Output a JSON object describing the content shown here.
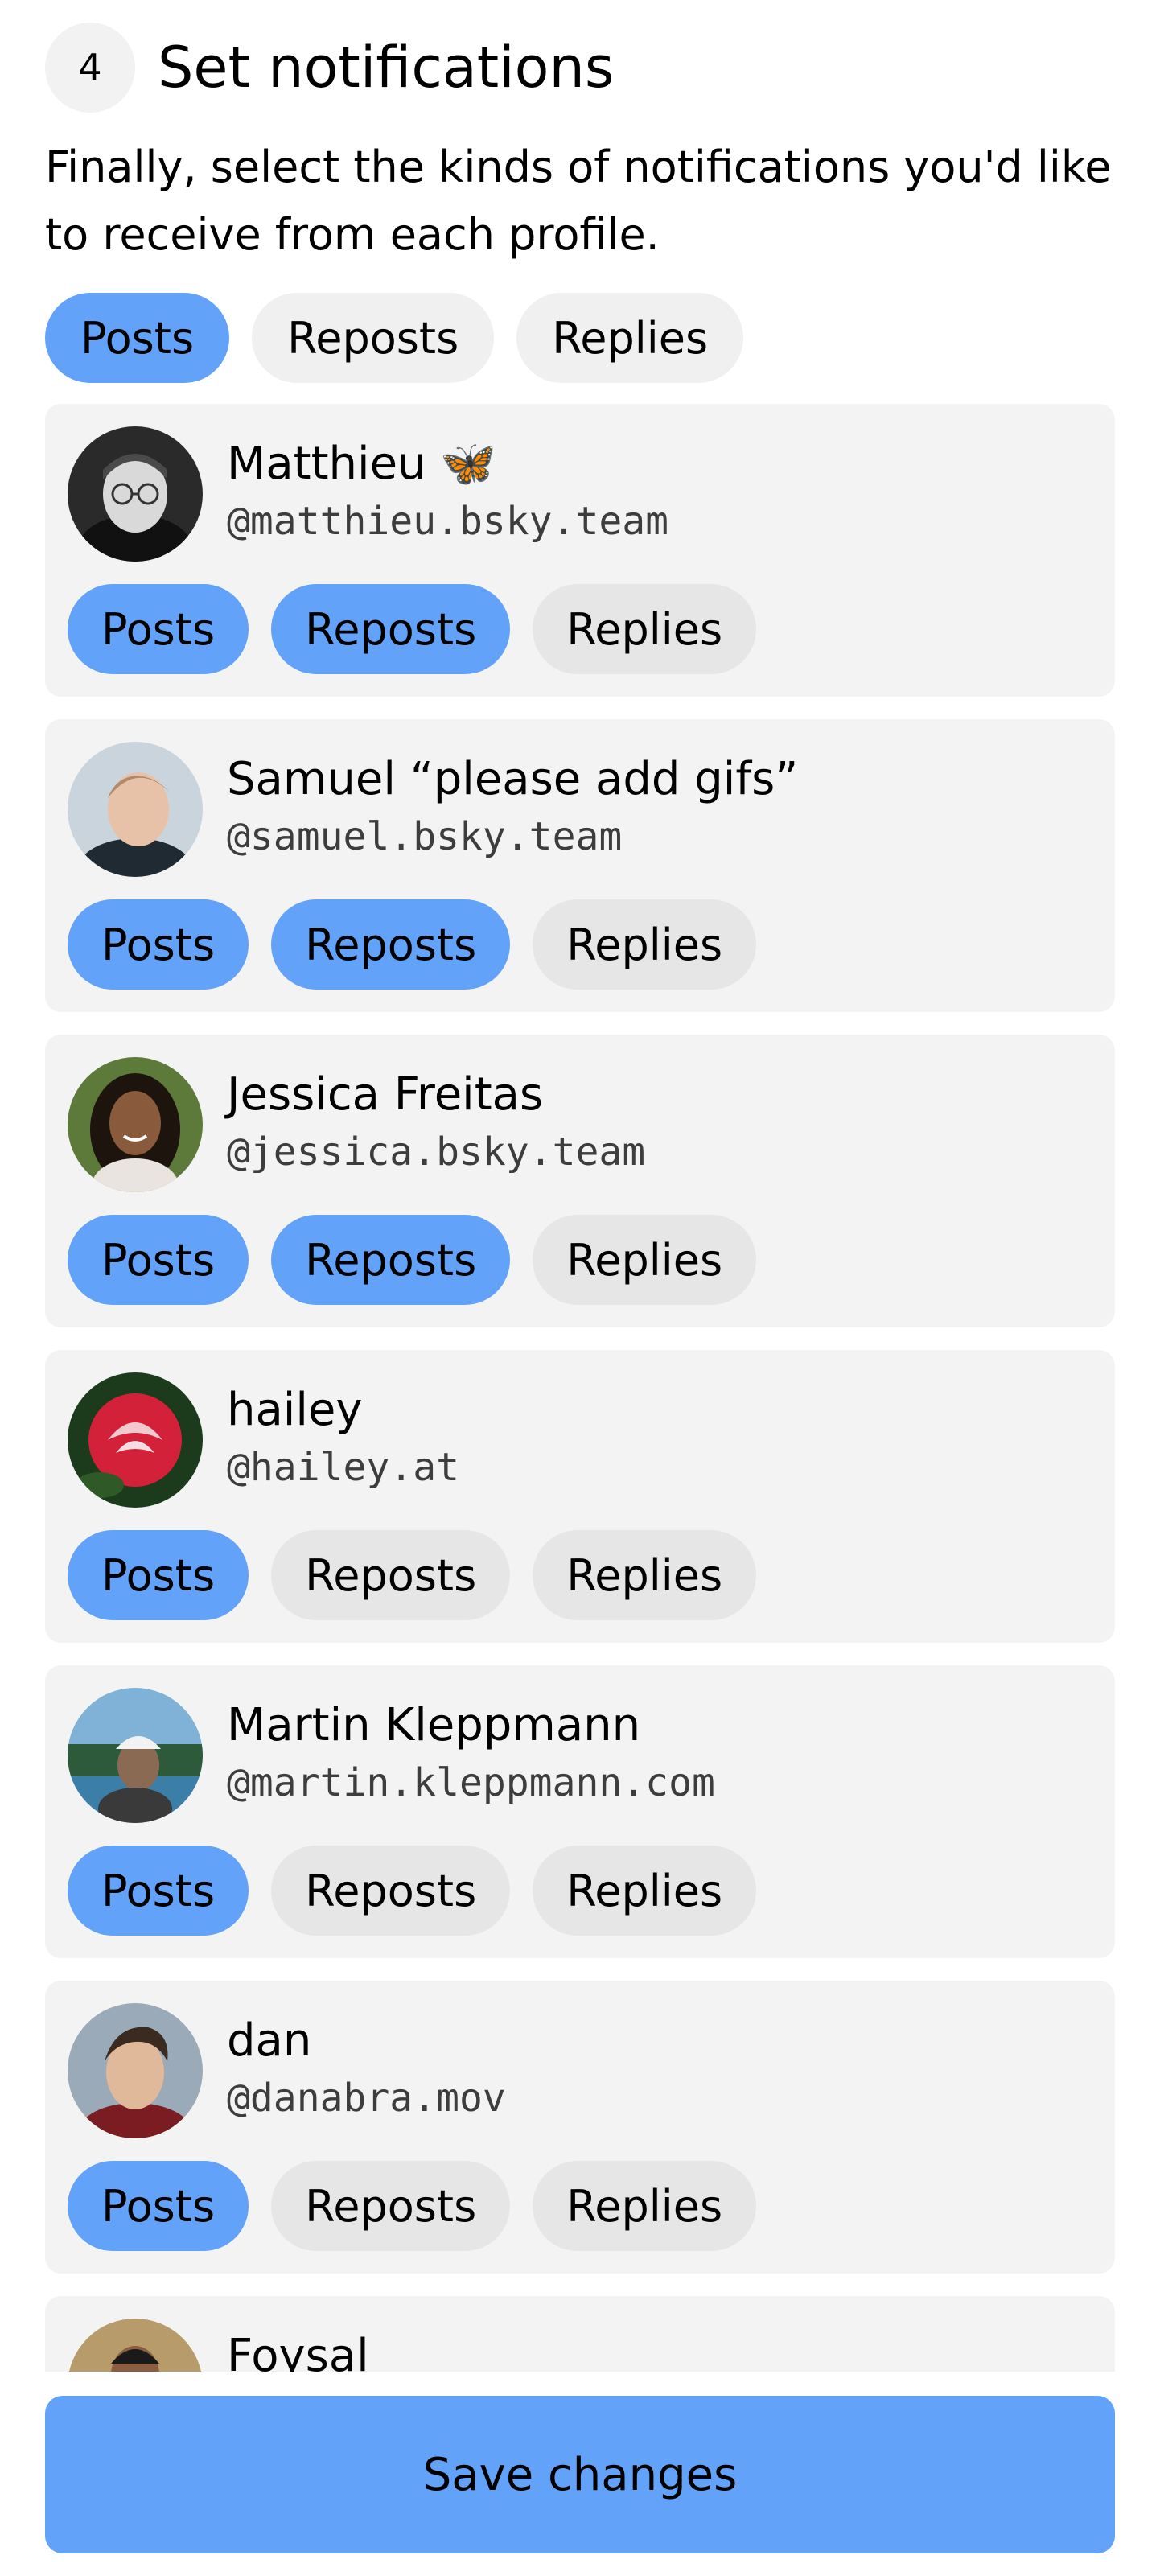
{
  "header": {
    "step_number": "4",
    "title": "Set notifications"
  },
  "intro": "Finally, select the kinds of notifications you'd like to receive from each profile.",
  "filter_tabs": [
    {
      "label": "Posts",
      "active": true
    },
    {
      "label": "Reposts",
      "active": false
    },
    {
      "label": "Replies",
      "active": false
    }
  ],
  "profiles": [
    {
      "name": "Matthieu 🦋",
      "handle": "@matthieu.bsky.team",
      "avatar": "avatar-matthieu",
      "toggles": [
        {
          "label": "Posts",
          "on": true
        },
        {
          "label": "Reposts",
          "on": true
        },
        {
          "label": "Replies",
          "on": false
        }
      ]
    },
    {
      "name": "Samuel “please add gifs”",
      "handle": "@samuel.bsky.team",
      "avatar": "avatar-samuel",
      "toggles": [
        {
          "label": "Posts",
          "on": true
        },
        {
          "label": "Reposts",
          "on": true
        },
        {
          "label": "Replies",
          "on": false
        }
      ]
    },
    {
      "name": "Jessica Freitas",
      "handle": "@jessica.bsky.team",
      "avatar": "avatar-jessica",
      "toggles": [
        {
          "label": "Posts",
          "on": true
        },
        {
          "label": "Reposts",
          "on": true
        },
        {
          "label": "Replies",
          "on": false
        }
      ]
    },
    {
      "name": "hailey",
      "handle": "@hailey.at",
      "avatar": "avatar-hailey",
      "toggles": [
        {
          "label": "Posts",
          "on": true
        },
        {
          "label": "Reposts",
          "on": false
        },
        {
          "label": "Replies",
          "on": false
        }
      ]
    },
    {
      "name": "Martin Kleppmann",
      "handle": "@martin.kleppmann.com",
      "avatar": "avatar-martin",
      "toggles": [
        {
          "label": "Posts",
          "on": true
        },
        {
          "label": "Reposts",
          "on": false
        },
        {
          "label": "Replies",
          "on": false
        }
      ]
    },
    {
      "name": "dan",
      "handle": "@danabra.mov",
      "avatar": "avatar-dan",
      "toggles": [
        {
          "label": "Posts",
          "on": true
        },
        {
          "label": "Reposts",
          "on": false
        },
        {
          "label": "Replies",
          "on": false
        }
      ]
    },
    {
      "name": "Foysal",
      "handle": "",
      "avatar": "avatar-foysal",
      "toggles": []
    }
  ],
  "save_button": "Save changes",
  "colors": {
    "active_pill": "#62a2f9",
    "inactive_pill": "#e6e6e6",
    "card_background": "#f3f3f3"
  }
}
